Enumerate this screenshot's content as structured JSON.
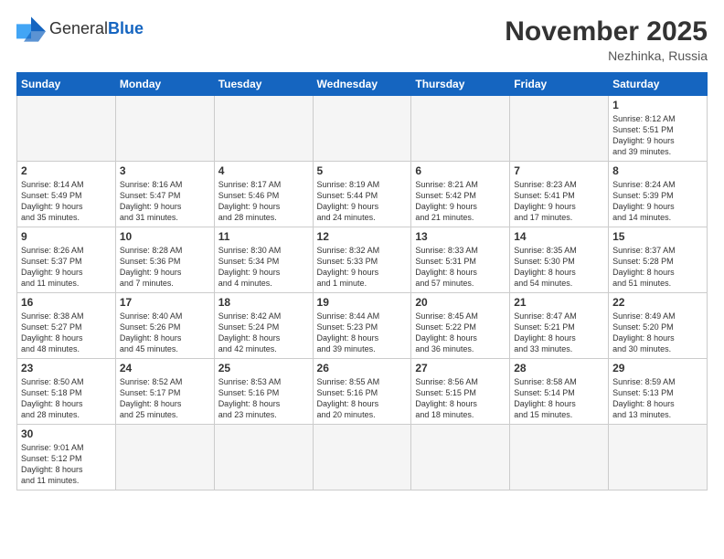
{
  "header": {
    "logo": {
      "general": "General",
      "blue": "Blue"
    },
    "title": "November 2025",
    "location": "Nezhinka, Russia"
  },
  "weekdays": [
    "Sunday",
    "Monday",
    "Tuesday",
    "Wednesday",
    "Thursday",
    "Friday",
    "Saturday"
  ],
  "weeks": [
    [
      {
        "day": "",
        "info": ""
      },
      {
        "day": "",
        "info": ""
      },
      {
        "day": "",
        "info": ""
      },
      {
        "day": "",
        "info": ""
      },
      {
        "day": "",
        "info": ""
      },
      {
        "day": "",
        "info": ""
      },
      {
        "day": "1",
        "info": "Sunrise: 8:12 AM\nSunset: 5:51 PM\nDaylight: 9 hours\nand 39 minutes."
      }
    ],
    [
      {
        "day": "2",
        "info": "Sunrise: 8:14 AM\nSunset: 5:49 PM\nDaylight: 9 hours\nand 35 minutes."
      },
      {
        "day": "3",
        "info": "Sunrise: 8:16 AM\nSunset: 5:47 PM\nDaylight: 9 hours\nand 31 minutes."
      },
      {
        "day": "4",
        "info": "Sunrise: 8:17 AM\nSunset: 5:46 PM\nDaylight: 9 hours\nand 28 minutes."
      },
      {
        "day": "5",
        "info": "Sunrise: 8:19 AM\nSunset: 5:44 PM\nDaylight: 9 hours\nand 24 minutes."
      },
      {
        "day": "6",
        "info": "Sunrise: 8:21 AM\nSunset: 5:42 PM\nDaylight: 9 hours\nand 21 minutes."
      },
      {
        "day": "7",
        "info": "Sunrise: 8:23 AM\nSunset: 5:41 PM\nDaylight: 9 hours\nand 17 minutes."
      },
      {
        "day": "8",
        "info": "Sunrise: 8:24 AM\nSunset: 5:39 PM\nDaylight: 9 hours\nand 14 minutes."
      }
    ],
    [
      {
        "day": "9",
        "info": "Sunrise: 8:26 AM\nSunset: 5:37 PM\nDaylight: 9 hours\nand 11 minutes."
      },
      {
        "day": "10",
        "info": "Sunrise: 8:28 AM\nSunset: 5:36 PM\nDaylight: 9 hours\nand 7 minutes."
      },
      {
        "day": "11",
        "info": "Sunrise: 8:30 AM\nSunset: 5:34 PM\nDaylight: 9 hours\nand 4 minutes."
      },
      {
        "day": "12",
        "info": "Sunrise: 8:32 AM\nSunset: 5:33 PM\nDaylight: 9 hours\nand 1 minute."
      },
      {
        "day": "13",
        "info": "Sunrise: 8:33 AM\nSunset: 5:31 PM\nDaylight: 8 hours\nand 57 minutes."
      },
      {
        "day": "14",
        "info": "Sunrise: 8:35 AM\nSunset: 5:30 PM\nDaylight: 8 hours\nand 54 minutes."
      },
      {
        "day": "15",
        "info": "Sunrise: 8:37 AM\nSunset: 5:28 PM\nDaylight: 8 hours\nand 51 minutes."
      }
    ],
    [
      {
        "day": "16",
        "info": "Sunrise: 8:38 AM\nSunset: 5:27 PM\nDaylight: 8 hours\nand 48 minutes."
      },
      {
        "day": "17",
        "info": "Sunrise: 8:40 AM\nSunset: 5:26 PM\nDaylight: 8 hours\nand 45 minutes."
      },
      {
        "day": "18",
        "info": "Sunrise: 8:42 AM\nSunset: 5:24 PM\nDaylight: 8 hours\nand 42 minutes."
      },
      {
        "day": "19",
        "info": "Sunrise: 8:44 AM\nSunset: 5:23 PM\nDaylight: 8 hours\nand 39 minutes."
      },
      {
        "day": "20",
        "info": "Sunrise: 8:45 AM\nSunset: 5:22 PM\nDaylight: 8 hours\nand 36 minutes."
      },
      {
        "day": "21",
        "info": "Sunrise: 8:47 AM\nSunset: 5:21 PM\nDaylight: 8 hours\nand 33 minutes."
      },
      {
        "day": "22",
        "info": "Sunrise: 8:49 AM\nSunset: 5:20 PM\nDaylight: 8 hours\nand 30 minutes."
      }
    ],
    [
      {
        "day": "23",
        "info": "Sunrise: 8:50 AM\nSunset: 5:18 PM\nDaylight: 8 hours\nand 28 minutes."
      },
      {
        "day": "24",
        "info": "Sunrise: 8:52 AM\nSunset: 5:17 PM\nDaylight: 8 hours\nand 25 minutes."
      },
      {
        "day": "25",
        "info": "Sunrise: 8:53 AM\nSunset: 5:16 PM\nDaylight: 8 hours\nand 23 minutes."
      },
      {
        "day": "26",
        "info": "Sunrise: 8:55 AM\nSunset: 5:16 PM\nDaylight: 8 hours\nand 20 minutes."
      },
      {
        "day": "27",
        "info": "Sunrise: 8:56 AM\nSunset: 5:15 PM\nDaylight: 8 hours\nand 18 minutes."
      },
      {
        "day": "28",
        "info": "Sunrise: 8:58 AM\nSunset: 5:14 PM\nDaylight: 8 hours\nand 15 minutes."
      },
      {
        "day": "29",
        "info": "Sunrise: 8:59 AM\nSunset: 5:13 PM\nDaylight: 8 hours\nand 13 minutes."
      }
    ],
    [
      {
        "day": "30",
        "info": "Sunrise: 9:01 AM\nSunset: 5:12 PM\nDaylight: 8 hours\nand 11 minutes."
      },
      {
        "day": "",
        "info": ""
      },
      {
        "day": "",
        "info": ""
      },
      {
        "day": "",
        "info": ""
      },
      {
        "day": "",
        "info": ""
      },
      {
        "day": "",
        "info": ""
      },
      {
        "day": "",
        "info": ""
      }
    ]
  ]
}
